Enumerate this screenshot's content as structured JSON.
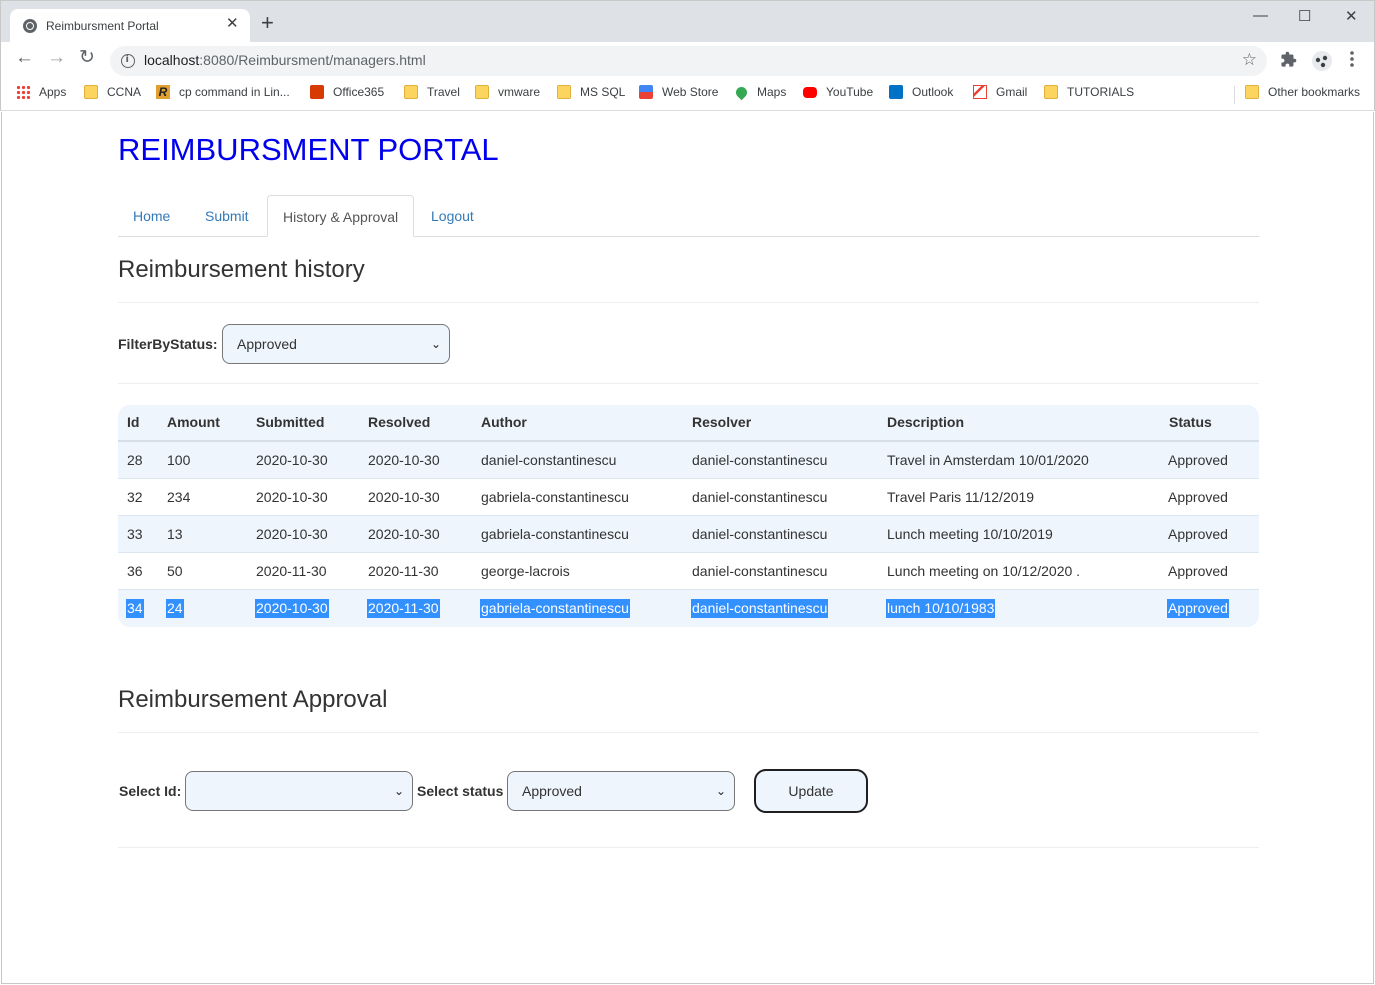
{
  "browser": {
    "tab_title": "Reimbursment Portal",
    "tab_close": "✕",
    "new_tab": "+",
    "url_host": "localhost",
    "url_rest": ":8080/Reimbursment/managers.html",
    "window": {
      "minimize": "—",
      "maximize": "☐",
      "close": "✕"
    },
    "nav": {
      "back": "←",
      "forward": "→",
      "reload": "↻"
    },
    "star": "☆",
    "bookmarks": [
      {
        "label": "Apps",
        "icon": "apps-grid-icon"
      },
      {
        "label": "CCNA",
        "icon": "folder-icon"
      },
      {
        "label": "cp command in Lin...",
        "icon": "r-icon"
      },
      {
        "label": "Office365",
        "icon": "office-icon"
      },
      {
        "label": "Travel",
        "icon": "folder-icon"
      },
      {
        "label": "vmware",
        "icon": "folder-icon"
      },
      {
        "label": "MS SQL",
        "icon": "folder-icon"
      },
      {
        "label": "Web Store",
        "icon": "web-store-icon"
      },
      {
        "label": "Maps",
        "icon": "maps-icon"
      },
      {
        "label": "YouTube",
        "icon": "youtube-icon"
      },
      {
        "label": "Outlook",
        "icon": "outlook-icon"
      },
      {
        "label": "Gmail",
        "icon": "gmail-icon"
      },
      {
        "label": "TUTORIALS",
        "icon": "folder-icon"
      }
    ],
    "other_bookmarks": "Other bookmarks"
  },
  "page": {
    "title": "REIMBURSMENT PORTAL",
    "tabs": [
      {
        "label": "Home"
      },
      {
        "label": "Submit"
      },
      {
        "label": "History & Approval"
      },
      {
        "label": "Logout"
      }
    ],
    "history_heading": "Reimbursement history",
    "filter_label": "FilterByStatus:",
    "filter_value": "Approved",
    "table": {
      "headers": [
        "Id",
        "Amount",
        "Submitted",
        "Resolved",
        "Author",
        "Resolver",
        "Description",
        "Status"
      ],
      "rows": [
        [
          "28",
          "100",
          "2020-10-30",
          "2020-10-30",
          "daniel-constantinescu",
          "daniel-constantinescu",
          "Travel in Amsterdam 10/01/2020",
          "Approved"
        ],
        [
          "32",
          "234",
          "2020-10-30",
          "2020-10-30",
          "gabriela-constantinescu",
          "daniel-constantinescu",
          "Travel Paris 11/12/2019",
          "Approved"
        ],
        [
          "33",
          "13",
          "2020-10-30",
          "2020-10-30",
          "gabriela-constantinescu",
          "daniel-constantinescu",
          "Lunch meeting 10/10/2019",
          "Approved"
        ],
        [
          "36",
          "50",
          "2020-11-30",
          "2020-11-30",
          "george-lacrois",
          "daniel-constantinescu",
          "Lunch meeting on 10/12/2020 .",
          "Approved"
        ],
        [
          "34",
          "24",
          "2020-10-30",
          "2020-11-30",
          "gabriela-constantinescu",
          "daniel-constantinescu",
          "lunch 10/10/1983",
          "Approved"
        ]
      ]
    },
    "approval_heading": "Reimbursement Approval",
    "select_id_label": "Select Id:",
    "select_id_value": "",
    "select_status_label": "Select status",
    "select_status_value": "Approved",
    "update_button": "Update",
    "chevron": "⌄"
  },
  "colors": {
    "title_link": "#0000ee",
    "tab_link": "#337ab7",
    "row_tint": "#eef5fc",
    "selection": "#3390ff"
  }
}
